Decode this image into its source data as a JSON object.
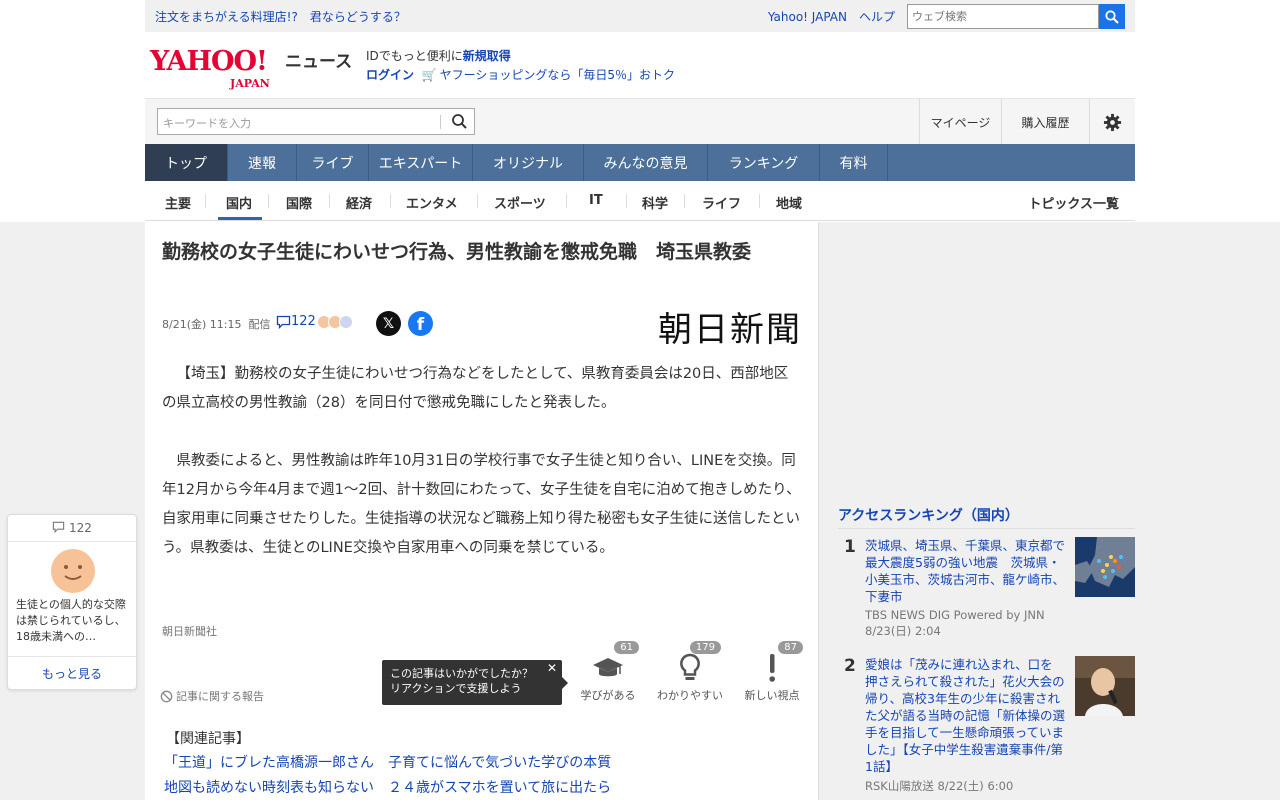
{
  "util": {
    "promo": "注文をまちがえる料理店!?　君ならどうする？",
    "yahoo_japan": "Yahoo! JAPAN",
    "help": "ヘルプ",
    "web_search_placeholder": "ウェブ検索"
  },
  "header": {
    "logo_main": "YAHOO!",
    "logo_sub": "JAPAN",
    "news_label": "ニュース",
    "promo_line1_prefix": "IDでもっと便利に",
    "promo_line1_link": "新規取得",
    "login": "ログイン",
    "promo_line2": "ヤフーショッピングなら「毎日5％」おトク"
  },
  "search": {
    "placeholder": "キーワードを入力",
    "mypage": "マイページ",
    "history": "購入履歴"
  },
  "nav": {
    "items": [
      "トップ",
      "速報",
      "ライブ",
      "エキスパート",
      "オリジナル",
      "みんなの意見",
      "ランキング",
      "有料"
    ]
  },
  "subnav": {
    "items": [
      "主要",
      "国内",
      "国際",
      "経済",
      "エンタメ",
      "スポーツ",
      "IT",
      "科学",
      "ライフ",
      "地域"
    ],
    "topics": "トピックス一覧"
  },
  "article": {
    "title": "勤務校の女子生徒にわいせつ行為、男性教諭を懲戒免職　埼玉県教委",
    "date": "8/21(金) 11:15",
    "delivered": "配信",
    "comments": "122",
    "publisher_logo": "朝日新聞",
    "paragraph1": "【埼玉】勤務校の女子生徒にわいせつ行為などをしたとして、県教育委員会は20日、西部地区の県立高校の男性教諭（28）を同日付で懲戒免職にしたと発表した。",
    "paragraph2": "県教委によると、男性教諭は昨年10月31日の学校行事で女子生徒と知り合い、LINEを交換。同年12月から今年4月まで週1～2回、計十数回にわたって、女子生徒を自宅に泊めて抱きしめたり、自家用車に同乗させたりした。生徒指導の状況など職務上知り得た秘密も女子生徒に送信したという。県教委は、生徒とのLINE交換や自家用車への同乗を禁じている。",
    "source": "朝日新聞社",
    "report": "記事に関する報告",
    "tooltip_line1": "この記事はいかがでしたか？",
    "tooltip_line2": "リアクションで支援しよう",
    "reactions": [
      {
        "label": "学びがある",
        "count": "61",
        "icon": "graduation-cap-icon"
      },
      {
        "label": "わかりやすい",
        "count": "179",
        "icon": "lightbulb-icon"
      },
      {
        "label": "新しい視点",
        "count": "87",
        "icon": "exclamation-icon"
      }
    ],
    "related_title": "【関連記事】",
    "related": [
      "「王道」にブレた高橋源一郎さん　子育てに悩んで気づいた学びの本質",
      "地図も読めない時刻表も知らない　２４歳がスマホを置いて旅に出たら"
    ]
  },
  "ranking": {
    "title": "アクセスランキング（国内）",
    "items": [
      {
        "rank": "1",
        "title": "茨城県、埼玉県、千葉県、東京都で最大震度5弱の強い地震　茨城県・小美玉市、茨城古河市、龍ケ崎市、下妻市",
        "source": "TBS NEWS DIG Powered by JNN",
        "date": "8/23(日) 2:04"
      },
      {
        "rank": "2",
        "title": "愛娘は「茂みに連れ込まれ、口を押さえられて殺された」花火大会の帰り、高校3年生の少年に殺害された父が語る当時の記憶「新体操の選手を目指して一生懸命頑張っていました」【女子中学生殺害遺棄事件/第1話】",
        "source": "RSK山陽放送 8/22(土) 6:00"
      }
    ]
  },
  "comment_card": {
    "count": "122",
    "text": "生徒との個人的な交際は禁じられているし、18歳未満への…",
    "more": "もっと見る"
  }
}
